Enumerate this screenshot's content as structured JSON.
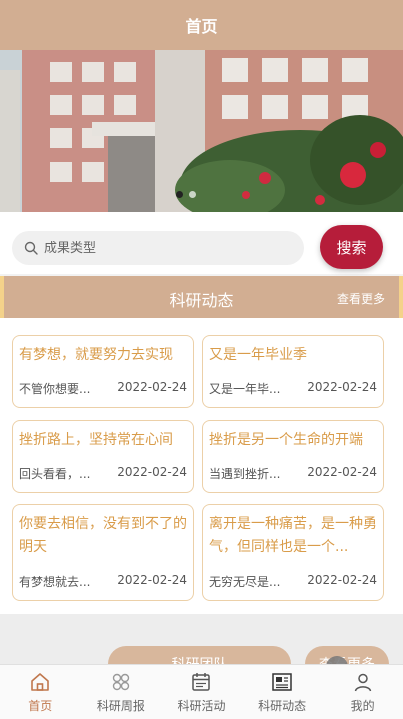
{
  "header": {
    "title": "首页"
  },
  "search": {
    "placeholder": "成果类型",
    "button_label": "搜索"
  },
  "section": {
    "title": "科研动态",
    "more_label": "查看更多"
  },
  "news": [
    {
      "title": "有梦想，就要努力去实现",
      "excerpt": "不管你想要...",
      "date": "2022-02-24"
    },
    {
      "title": "又是一年毕业季",
      "excerpt": "又是一年毕...",
      "date": "2022-02-24"
    },
    {
      "title": "挫折路上，坚持常在心间",
      "excerpt": "回头看看，...",
      "date": "2022-02-24"
    },
    {
      "title": "挫折是另一个生命的开端",
      "excerpt": "当遇到挫折...",
      "date": "2022-02-24"
    },
    {
      "title": "你要去相信，没有到不了的明天",
      "excerpt": "有梦想就去...",
      "date": "2022-02-24"
    },
    {
      "title": "离开是一种痛苦，是一种勇气，但同样也是一个...",
      "excerpt": "无穷无尽是...",
      "date": "2022-02-24"
    }
  ],
  "partial_buttons": {
    "left": "科研团队",
    "right": "查看更多"
  },
  "tabbar": [
    {
      "label": "首页",
      "icon": "home-icon",
      "active": true
    },
    {
      "label": "科研周报",
      "icon": "grid-circles-icon",
      "active": false
    },
    {
      "label": "科研活动",
      "icon": "calendar-icon",
      "active": false
    },
    {
      "label": "科研动态",
      "icon": "newspaper-icon",
      "active": false
    },
    {
      "label": "我的",
      "icon": "user-icon",
      "active": false
    }
  ],
  "colors": {
    "theme": "#d2ae92",
    "accent": "#b61d3a",
    "card_title": "#d99c4a",
    "tab_active": "#c0774d"
  }
}
